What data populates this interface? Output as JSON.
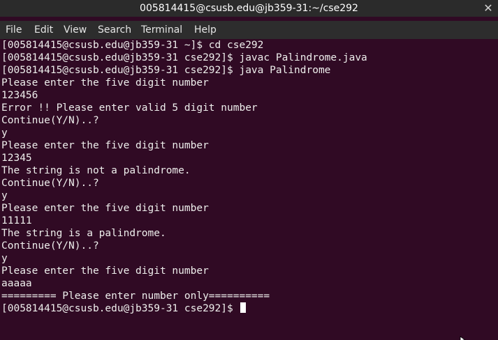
{
  "window": {
    "title": "005814415@csusb.edu@jb359-31:~/cse292"
  },
  "menubar": {
    "items": [
      "File",
      "Edit",
      "View",
      "Search",
      "Terminal",
      "Help"
    ]
  },
  "terminal": {
    "lines": [
      "[005814415@csusb.edu@jb359-31 ~]$ cd cse292",
      "[005814415@csusb.edu@jb359-31 cse292]$ javac Palindrome.java",
      "[005814415@csusb.edu@jb359-31 cse292]$ java Palindrome",
      "Please enter the five digit number",
      "123456",
      "Error !! Please enter valid 5 digit number",
      "Continue(Y/N)..?",
      "y",
      "Please enter the five digit number",
      "12345",
      "The string is not a palindrome.",
      "Continue(Y/N)..?",
      "y",
      "Please enter the five digit number",
      "11111",
      "The string is a palindrome.",
      "Continue(Y/N)..?",
      "y",
      "Please enter the five digit number",
      "aaaaa",
      "========= Please enter number only=========="
    ],
    "prompt": "[005814415@csusb.edu@jb359-31 cse292]$ "
  },
  "colors": {
    "background": "#300a24",
    "text": "#eeeeec",
    "titlebar": "#2b2b2b",
    "menubar": "#2d2d2d"
  },
  "icons": {
    "close": "close-icon",
    "pointer": "mouse-pointer-icon"
  }
}
